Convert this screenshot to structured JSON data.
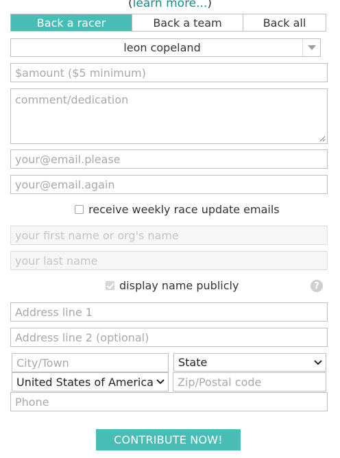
{
  "intro": {
    "open_paren": "(",
    "learn_more": "learn more...",
    "close_paren": ")"
  },
  "tabs": [
    {
      "label": "Back a racer",
      "active": true
    },
    {
      "label": "Back a team",
      "active": false
    },
    {
      "label": "Back all",
      "active": false
    }
  ],
  "racer_select": {
    "value": "leon copeland"
  },
  "amount": {
    "placeholder": "$amount ($5 minimum)"
  },
  "comment": {
    "placeholder": "comment/dedication"
  },
  "email": {
    "placeholder": "your@email.please"
  },
  "email_confirm": {
    "placeholder": "your@email.again"
  },
  "weekly_updates": {
    "label": "receive weekly race update emails",
    "checked": false
  },
  "first_name": {
    "placeholder": "your first name or org's name"
  },
  "last_name": {
    "placeholder": "your last name"
  },
  "display_public": {
    "label": "display name publicly",
    "checked": true
  },
  "help": {
    "glyph": "?"
  },
  "address1": {
    "placeholder": "Address line 1"
  },
  "address2": {
    "placeholder": "Address line 2 (optional)"
  },
  "city": {
    "placeholder": "City/Town"
  },
  "state": {
    "value": "State"
  },
  "country": {
    "value": "United States of America"
  },
  "zip": {
    "placeholder": "Zip/Postal code"
  },
  "phone": {
    "placeholder": "Phone"
  },
  "submit": {
    "label": "CONTRIBUTE NOW!"
  },
  "colors": {
    "accent": "#48bdb5",
    "link": "#1a8a8a",
    "border": "#bdbdbd",
    "placeholder": "#a8a8a8"
  }
}
